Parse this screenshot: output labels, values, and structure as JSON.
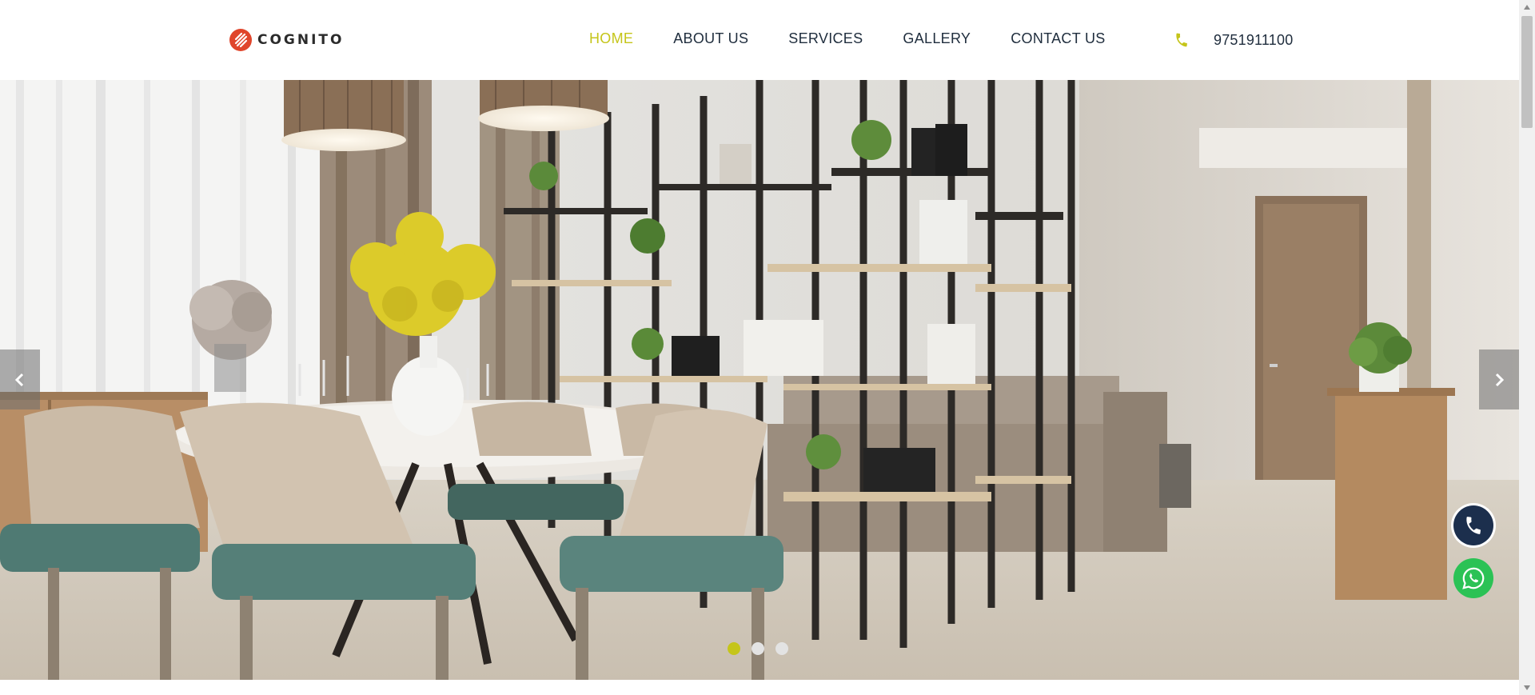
{
  "brand": {
    "name": "COGNITO",
    "logo_icon": "cognito-logo-icon",
    "accent_color": "#c5c51a",
    "logo_color": "#e0452b"
  },
  "nav": {
    "items": [
      {
        "label": "HOME",
        "active": true
      },
      {
        "label": "ABOUT US",
        "active": false
      },
      {
        "label": "SERVICES",
        "active": false
      },
      {
        "label": "GALLERY",
        "active": false
      },
      {
        "label": "CONTACT US",
        "active": false
      }
    ]
  },
  "contact": {
    "phone_icon": "phone-icon",
    "phone_number": "9751911100"
  },
  "hero": {
    "image": "dining-room-interior-photo",
    "prev_icon": "chevron-left-icon",
    "next_icon": "chevron-right-icon",
    "slides_total": 3,
    "active_slide": 1
  },
  "floating": {
    "call_icon": "phone-icon",
    "whatsapp_icon": "whatsapp-icon",
    "call_color": "#1c2f4d",
    "whatsapp_color": "#2bc255"
  }
}
